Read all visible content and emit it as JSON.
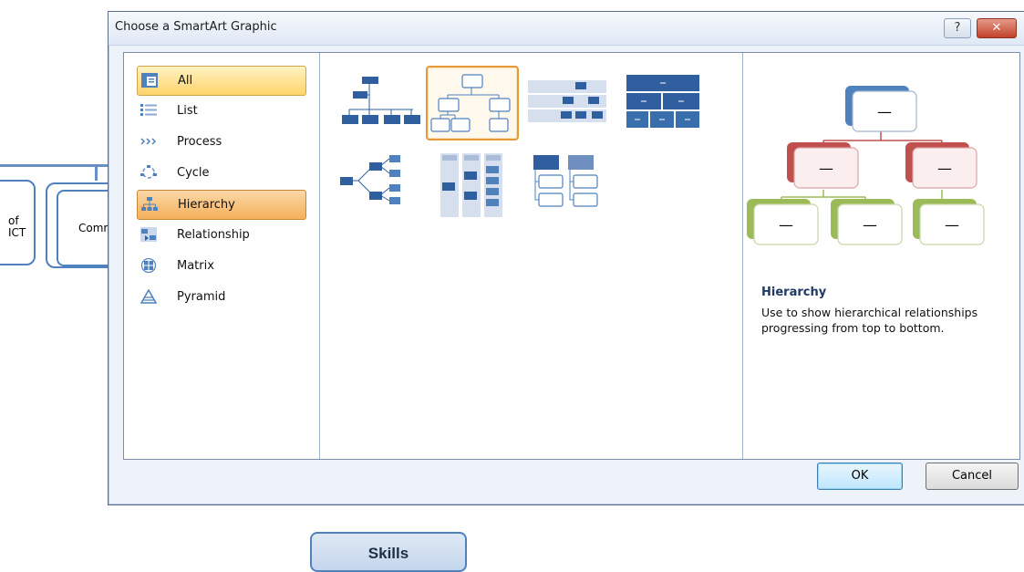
{
  "background": {
    "shape_left_text": "of\nICT",
    "shape_mid_text": "Comm",
    "skills_label": "Skills"
  },
  "dialog": {
    "title": "Choose a SmartArt Graphic",
    "help_label": "?",
    "close_label": "✕",
    "categories": [
      {
        "label": "All",
        "icon": "all-icon",
        "state": "selected"
      },
      {
        "label": "List",
        "icon": "list-icon"
      },
      {
        "label": "Process",
        "icon": "process-icon"
      },
      {
        "label": "Cycle",
        "icon": "cycle-icon"
      },
      {
        "label": "Hierarchy",
        "icon": "hierarchy-icon",
        "state": "active"
      },
      {
        "label": "Relationship",
        "icon": "relationship-icon"
      },
      {
        "label": "Matrix",
        "icon": "matrix-icon"
      },
      {
        "label": "Pyramid",
        "icon": "pyramid-icon"
      }
    ],
    "layouts": [
      {
        "name": "organization-chart"
      },
      {
        "name": "hierarchy",
        "selected": true
      },
      {
        "name": "labeled-hierarchy"
      },
      {
        "name": "table-hierarchy"
      },
      {
        "name": "horizontal-hierarchy"
      },
      {
        "name": "horizontal-labeled-hierarchy"
      },
      {
        "name": "hierarchy-list"
      }
    ],
    "preview": {
      "title": "Hierarchy",
      "description": "Use to show hierarchical relationships progressing from top to bottom.",
      "node_placeholder": "—"
    },
    "ok_label": "OK",
    "cancel_label": "Cancel"
  },
  "colors": {
    "accent_blue": "#4f81bd",
    "red": "#c0504d",
    "green": "#9bbb59",
    "selection_orange": "#f5b15a"
  }
}
